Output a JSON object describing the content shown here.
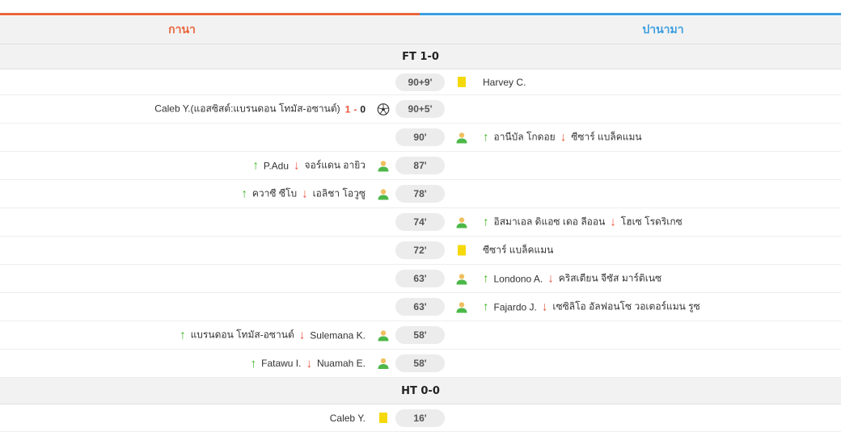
{
  "teams": {
    "home": "กานา",
    "away": "ปานามา"
  },
  "colors": {
    "home": "#e8643a",
    "away": "#3a9ee0",
    "up": "#3cb521",
    "down": "#e8543a",
    "card": "#f5d90a"
  },
  "sections": {
    "ft": "FT 1-0",
    "ht": "HT 0-0"
  },
  "events": [
    {
      "minute": "90+9'",
      "side": "away",
      "type": "yellow-card",
      "player": "Harvey C."
    },
    {
      "minute": "90+5'",
      "side": "home",
      "type": "goal",
      "player": "Caleb Y.(แอสซิสต์:แบรนดอน โทมัส-อซานต์)",
      "score_home": "1",
      "score_sep": "-",
      "score_away": "0"
    },
    {
      "minute": "90'",
      "side": "away",
      "type": "substitution",
      "in": "อานีบัล โกดอย",
      "out": "ซีซาร์ แบล็คแมน"
    },
    {
      "minute": "87'",
      "side": "home",
      "type": "substitution",
      "in": "P.Adu",
      "out": "จอร์แดน อายิว"
    },
    {
      "minute": "78'",
      "side": "home",
      "type": "substitution",
      "in": "ควาซี ซีโบ",
      "out": "เอลิชา โอวูซู"
    },
    {
      "minute": "74'",
      "side": "away",
      "type": "substitution",
      "in": "อิสมาเอล ดิแอซ เดอ ลีออน",
      "out": "โฮเซ โรดริเกซ"
    },
    {
      "minute": "72'",
      "side": "away",
      "type": "yellow-card",
      "player": "ซีซาร์ แบล็คแมน"
    },
    {
      "minute": "63'",
      "side": "away",
      "type": "substitution",
      "in": "Londono A.",
      "out": "คริสเตียน จีซัส มาร์ติเนซ"
    },
    {
      "minute": "63'",
      "side": "away",
      "type": "substitution",
      "in": "Fajardo J.",
      "out": "เซซิลิโอ อัลฟอนโซ วอเตอร์แมน รูซ"
    },
    {
      "minute": "58'",
      "side": "home",
      "type": "substitution",
      "in": "แบรนดอน โทมัส-อซานต์",
      "out": "Sulemana K."
    },
    {
      "minute": "58'",
      "side": "home",
      "type": "substitution",
      "in": "Fatawu I.",
      "out": "Nuamah E."
    },
    {
      "minute": "16'",
      "side": "home",
      "type": "yellow-card",
      "player": "Caleb Y."
    }
  ],
  "icons": {
    "yellow": "yellow-card-icon",
    "sub": "substitution-player-icon",
    "goal": "soccer-ball-icon",
    "up": "arrow-up-icon",
    "down": "arrow-down-icon"
  }
}
